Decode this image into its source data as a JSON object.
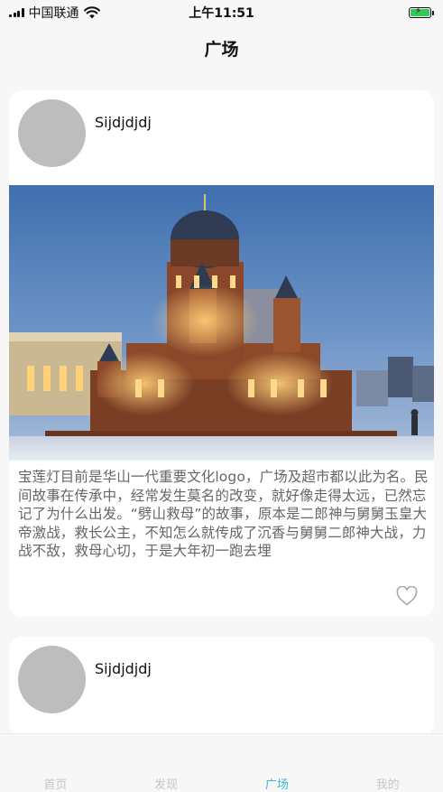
{
  "status_bar": {
    "carrier": "中国联通",
    "time": "上午11:51"
  },
  "header": {
    "title": "广场"
  },
  "posts": [
    {
      "username": "Sijdjdjdj",
      "image_alt": "cathedral-photo",
      "text": "宝莲灯目前是华山一代重要文化logo，广场及超市都以此为名。民间故事在传承中，经常发生莫名的改变，就好像走得太远，已然忘记了为什么出发。“劈山救母”的故事，原本是二郎神与舅舅玉皇大帝激战，救长公主，不知怎么就传成了沉香与舅舅二郎神大战，力战不敌，救母心切，于是大年初一跑去埋",
      "like_icon": "heart-outline-icon"
    },
    {
      "username": "Sijdjdjdj"
    }
  ],
  "tab_bar": {
    "items": [
      {
        "label": "首页"
      },
      {
        "label": "发现"
      },
      {
        "label": "广场"
      },
      {
        "label": "我的"
      }
    ],
    "active_color": "#35b8d8",
    "inactive_color": "#c6c6c6"
  }
}
